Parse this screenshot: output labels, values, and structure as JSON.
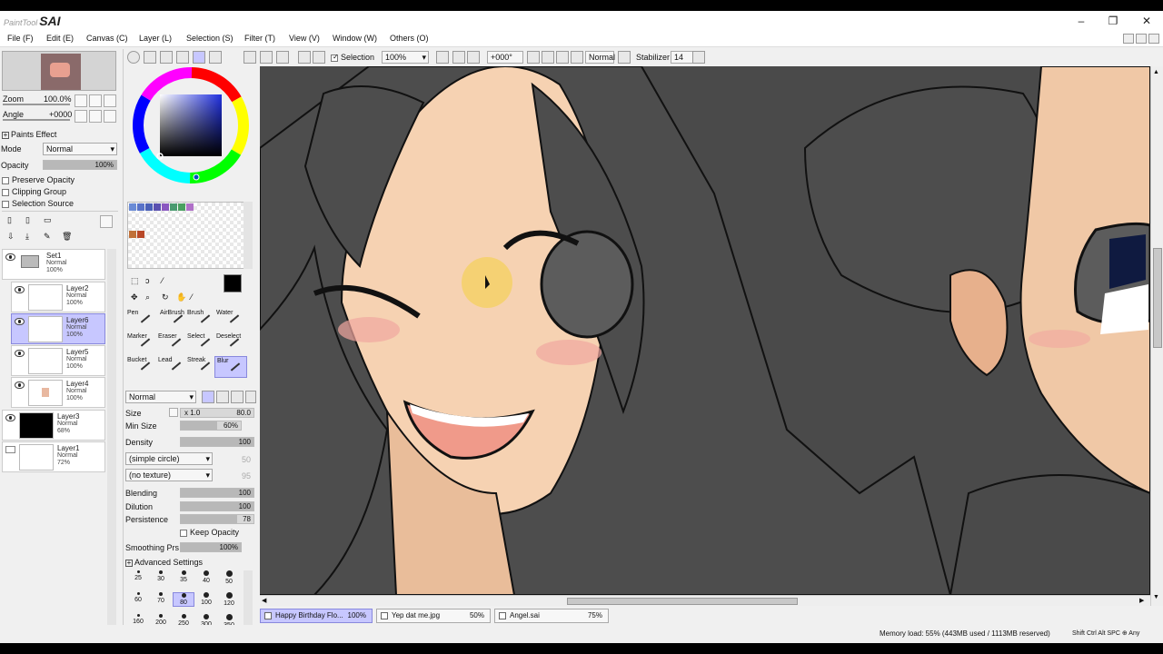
{
  "app": {
    "logo_small": "PaintTool",
    "logo_big": "SAI"
  },
  "menu": [
    "File (F)",
    "Edit (E)",
    "Canvas (C)",
    "Layer (L)",
    "Selection (S)",
    "Filter (T)",
    "View (V)",
    "Window (W)",
    "Others (O)"
  ],
  "toolbar": {
    "selection_label": "Selection",
    "zoom": "100%",
    "angle": "+000°",
    "mode": "Normal",
    "stabilizer_label": "Stabilizer",
    "stabilizer": "14"
  },
  "navigator": {
    "zoom_label": "Zoom",
    "zoom_value": "100.0%",
    "angle_label": "Angle",
    "angle_value": "+0000"
  },
  "paints_effect": {
    "header": "Paints Effect",
    "mode_label": "Mode",
    "mode_value": "Normal",
    "opacity_label": "Opacity",
    "opacity_value": "100%",
    "opacity_fraction": 1.0,
    "preserve_opacity": "Preserve Opacity",
    "clipping_group": "Clipping Group",
    "selection_source": "Selection Source"
  },
  "layers": [
    {
      "name": "Set1",
      "mode": "Normal",
      "opacity": "100%"
    },
    {
      "name": "Layer2",
      "mode": "Normal",
      "opacity": "100%"
    },
    {
      "name": "Layer6",
      "mode": "Normal",
      "opacity": "100%"
    },
    {
      "name": "Layer5",
      "mode": "Normal",
      "opacity": "100%"
    },
    {
      "name": "Layer4",
      "mode": "Normal",
      "opacity": "100%"
    },
    {
      "name": "Layer3",
      "mode": "Normal",
      "opacity": "68%"
    },
    {
      "name": "Layer1",
      "mode": "Normal",
      "opacity": "72%"
    }
  ],
  "swatches": [
    "#6a8bd6",
    "#5872c8",
    "#4a60b8",
    "#5a50b0",
    "#8a58c0",
    "#4a9a70",
    "#4aa060",
    "#b070c8",
    "#c07038",
    "#b84828"
  ],
  "current_color": "#000000",
  "tools": [
    "Pen",
    "AirBrush",
    "Brush",
    "Water",
    "Marker",
    "Eraser",
    "Select",
    "Deselect",
    "Bucket",
    "Lead",
    "Streak",
    "Blur"
  ],
  "brush": {
    "blend_mode": "Normal",
    "size_label": "Size",
    "size_mult": "x 1.0",
    "size_value": "80.0",
    "minsize_label": "Min Size",
    "minsize_value": "60%",
    "density_label": "Density",
    "density_value": "100",
    "shape": "(simple circle)",
    "shape_value": "50",
    "texture": "(no texture)",
    "texture_value": "95",
    "blending_label": "Blending",
    "blending_value": "100",
    "dilution_label": "Dilution",
    "dilution_value": "100",
    "persistence_label": "Persistence",
    "persistence_value": "78",
    "keep_opacity": "Keep Opacity",
    "smoothing_label": "Smoothing Prs",
    "smoothing_value": "100%",
    "advanced": "Advanced Settings"
  },
  "brush_sizes": [
    "25",
    "30",
    "35",
    "40",
    "50",
    "60",
    "70",
    "80",
    "100",
    "120",
    "160",
    "200",
    "250",
    "300",
    "350"
  ],
  "tabs": [
    {
      "name": "Happy Birthday Flo...",
      "zoom": "100%"
    },
    {
      "name": "Yep dat me.jpg",
      "zoom": "50%"
    },
    {
      "name": "Angel.sai",
      "zoom": "75%"
    }
  ],
  "status": {
    "memory": "Memory load: 55% (443MB used / 1113MB reserved)",
    "keys": "Shift Ctrl Alt SPC ⊕ Any"
  },
  "colors": {
    "canvas_bg": "#4a4a4a",
    "hair": "#4d4d4d",
    "skin": "#f6d2b2",
    "blush": "#f1a6a0",
    "selected": "#c7c7ff"
  }
}
